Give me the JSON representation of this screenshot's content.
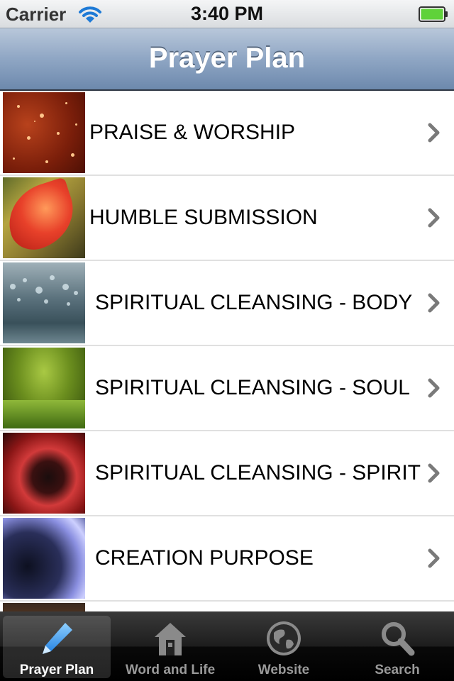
{
  "status_bar": {
    "carrier": "Carrier",
    "time": "3:40 PM"
  },
  "nav": {
    "title": "Prayer Plan"
  },
  "list": {
    "items": [
      {
        "label": "PRAISE & WORSHIP",
        "thumbnail": "sparks-image"
      },
      {
        "label": "HUMBLE SUBMISSION",
        "thumbnail": "red-leaf-image"
      },
      {
        "label": "SPIRITUAL CLEANSING - BODY",
        "thumbnail": "water-drops-image"
      },
      {
        "label": "SPIRITUAL CLEANSING - SOUL",
        "thumbnail": "green-grass-image"
      },
      {
        "label": "SPIRITUAL CLEANSING - SPIRIT",
        "thumbnail": "red-flower-image"
      },
      {
        "label": "CREATION PURPOSE",
        "thumbnail": "earth-image"
      }
    ]
  },
  "tab_bar": {
    "tabs": [
      {
        "label": "Prayer Plan",
        "icon": "pencil-icon",
        "selected": true
      },
      {
        "label": "Word and Life",
        "icon": "house-icon",
        "selected": false
      },
      {
        "label": "Website",
        "icon": "globe-icon",
        "selected": false
      },
      {
        "label": "Search",
        "icon": "search-icon",
        "selected": false
      }
    ]
  },
  "colors": {
    "nav_bar": "#8fa6c4",
    "battery": "#5fd23a",
    "wifi": "#1e7ad6",
    "tab_bar": "#1d1d1d"
  }
}
